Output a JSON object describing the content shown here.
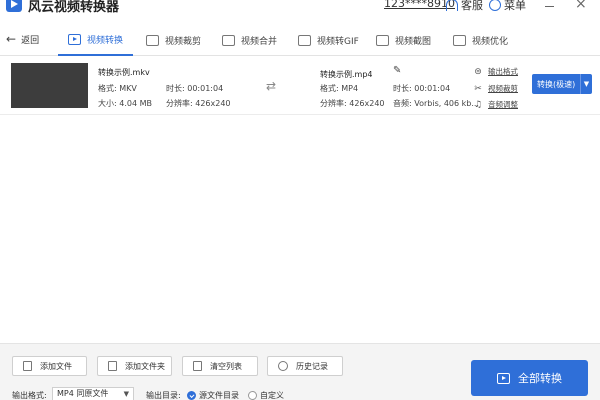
{
  "window": {
    "title": "风云视频转换器",
    "account": "123****8910",
    "service_label": "客服",
    "menu_label": "菜单",
    "close_glyph": "×"
  },
  "nav": {
    "back_label": "返回",
    "tabs": [
      {
        "label": "视频转换",
        "active": true,
        "icon": "video-play-icon"
      },
      {
        "label": "视频裁剪",
        "active": false,
        "icon": "crop-icon"
      },
      {
        "label": "视频合并",
        "active": false,
        "icon": "merge-icon"
      },
      {
        "label": "视频转GIF",
        "active": false,
        "icon": "gif-icon"
      },
      {
        "label": "视频截图",
        "active": false,
        "icon": "screenshot-icon"
      },
      {
        "label": "视频优化",
        "active": false,
        "icon": "sliders-icon"
      }
    ]
  },
  "file": {
    "source": {
      "name": "转换示例.mkv",
      "format": "格式: MKV",
      "duration": "时长: 00:01:04",
      "size": "大小: 4.04 MB",
      "resolution": "分辨率: 426x240"
    },
    "output": {
      "name": "转换示例.mp4",
      "format": "格式: MP4",
      "duration": "时长: 00:01:04",
      "resolution": "分辨率: 426x240",
      "audio": "音频: Vorbis, 406 kb..."
    },
    "links": [
      {
        "label": "输出格式",
        "icon": "settings-circle-icon"
      },
      {
        "label": "视频裁剪",
        "icon": "scissors-icon"
      },
      {
        "label": "音频调整",
        "icon": "music-note-icon"
      }
    ],
    "convert_button": "转换(极速)"
  },
  "bottom": {
    "buttons": [
      {
        "label": "添加文件",
        "icon": "add-file-icon"
      },
      {
        "label": "添加文件夹",
        "icon": "add-folder-icon"
      },
      {
        "label": "清空列表",
        "icon": "trash-icon"
      },
      {
        "label": "历史记录",
        "icon": "clock-icon"
      }
    ],
    "output_format_label": "输出格式:",
    "output_format_value": "MP4 同原文件",
    "output_dir_label": "输出目录:",
    "dir_options": [
      {
        "label": "源文件目录",
        "checked": true
      },
      {
        "label": "自定义",
        "checked": false
      }
    ],
    "convert_all": "全部转换"
  },
  "colors": {
    "accent": "#2f6fd8",
    "thumbnail": "#3d3d3d",
    "bottom_bar": "#f4f4f4"
  }
}
